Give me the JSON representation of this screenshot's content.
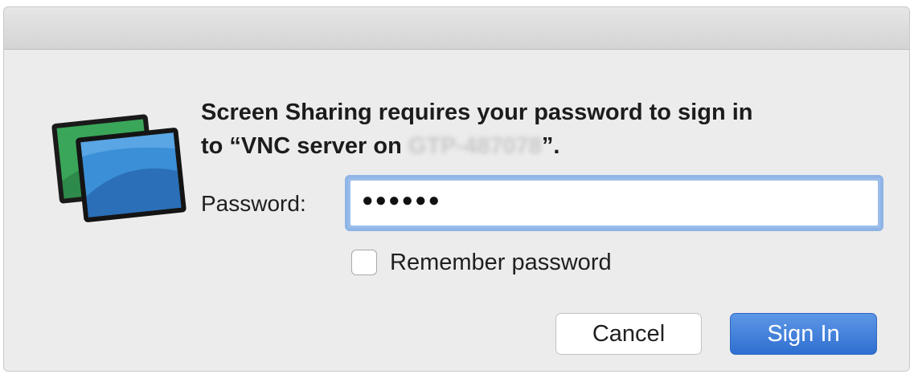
{
  "dialog": {
    "message_line1": "Screen Sharing requires your password to sign in",
    "message_line2_prefix": "to “VNC server on ",
    "server_name_obscured": "GTP-487078",
    "message_line2_suffix": "”."
  },
  "password": {
    "label": "Password:",
    "masked_value": "●●●●●●"
  },
  "remember": {
    "label": "Remember password",
    "checked": false
  },
  "buttons": {
    "cancel": "Cancel",
    "sign_in": "Sign In"
  },
  "icon": {
    "name": "screen-sharing-app-icon"
  },
  "colors": {
    "primary_button": "#3b7ddb",
    "focus_ring": "#8fb4e6",
    "dialog_background": "#ececec"
  }
}
